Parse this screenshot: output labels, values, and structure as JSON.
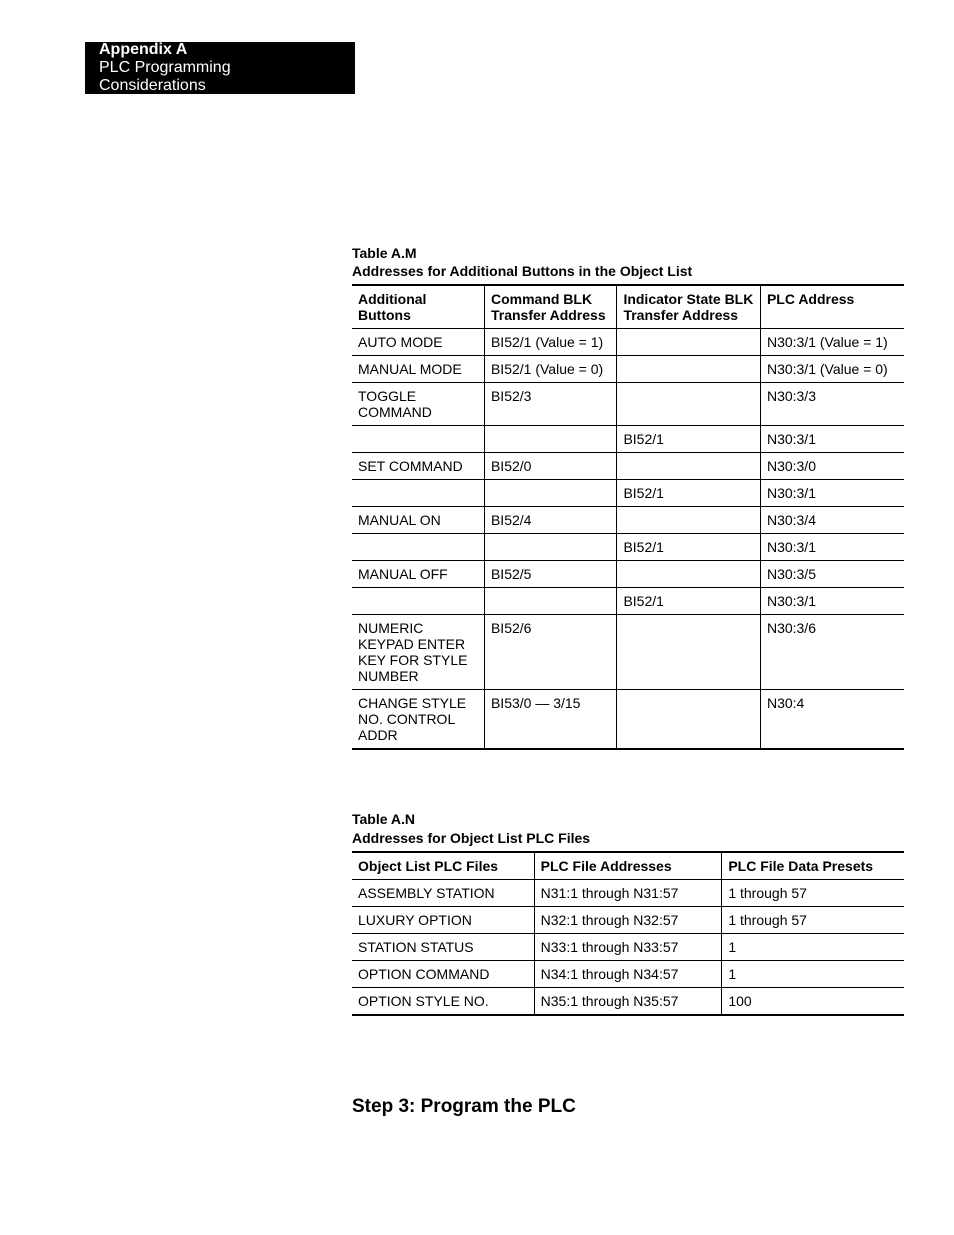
{
  "header": {
    "appendix": "Appendix A",
    "subtitle": "PLC Programming Considerations"
  },
  "tableM": {
    "caption_line1": "Table A.M",
    "caption_line2": "Addresses for Additional Buttons in the Object List",
    "headers": {
      "c1": "Additional Buttons",
      "c2": "Command BLK Transfer Address",
      "c3": "Indicator State BLK Transfer Address",
      "c4": "PLC Address"
    },
    "rows": [
      {
        "c1": "AUTO MODE",
        "c2": "BI52/1 (Value = 1)",
        "c3": "",
        "c4": "N30:3/1 (Value = 1)"
      },
      {
        "c1": "MANUAL MODE",
        "c2": "BI52/1 (Value = 0)",
        "c3": "",
        "c4": "N30:3/1 (Value = 0)"
      },
      {
        "c1": "TOGGLE COMMAND",
        "c2": "BI52/3",
        "c3": "",
        "c4": "N30:3/3"
      },
      {
        "c1": "",
        "c2": "",
        "c3": "BI52/1",
        "c4": "N30:3/1"
      },
      {
        "c1": "SET COMMAND",
        "c2": "BI52/0",
        "c3": "",
        "c4": "N30:3/0"
      },
      {
        "c1": "",
        "c2": "",
        "c3": "BI52/1",
        "c4": "N30:3/1"
      },
      {
        "c1": "MANUAL ON",
        "c2": "BI52/4",
        "c3": "",
        "c4": "N30:3/4"
      },
      {
        "c1": "",
        "c2": "",
        "c3": "BI52/1",
        "c4": "N30:3/1"
      },
      {
        "c1": "MANUAL OFF",
        "c2": "BI52/5",
        "c3": "",
        "c4": "N30:3/5"
      },
      {
        "c1": "",
        "c2": "",
        "c3": "BI52/1",
        "c4": "N30:3/1"
      },
      {
        "c1": "NUMERIC KEYPAD ENTER KEY FOR STYLE NUMBER",
        "c2": "BI52/6",
        "c3": "",
        "c4": "N30:3/6"
      },
      {
        "c1": "CHANGE STYLE NO. CONTROL ADDR",
        "c2": "BI53/0 — 3/15",
        "c3": "",
        "c4": "N30:4"
      }
    ]
  },
  "tableN": {
    "caption_line1": "Table A.N",
    "caption_line2": "Addresses for Object List PLC Files",
    "headers": {
      "c1": "Object List PLC Files",
      "c2": "PLC File Addresses",
      "c3": "PLC File Data Presets"
    },
    "rows": [
      {
        "c1": "ASSEMBLY STATION",
        "c2": "N31:1 through N31:57",
        "c3": "1 through 57"
      },
      {
        "c1": "LUXURY OPTION",
        "c2": "N32:1 through N32:57",
        "c3": "1 through 57"
      },
      {
        "c1": "STATION STATUS",
        "c2": "N33:1 through N33:57",
        "c3": "1"
      },
      {
        "c1": "OPTION COMMAND",
        "c2": "N34:1 through N34:57",
        "c3": "1"
      },
      {
        "c1": "OPTION STYLE NO.",
        "c2": "N35:1 through N35:57",
        "c3": "100"
      }
    ]
  },
  "step": {
    "heading": "Step 3:  Program the PLC"
  }
}
